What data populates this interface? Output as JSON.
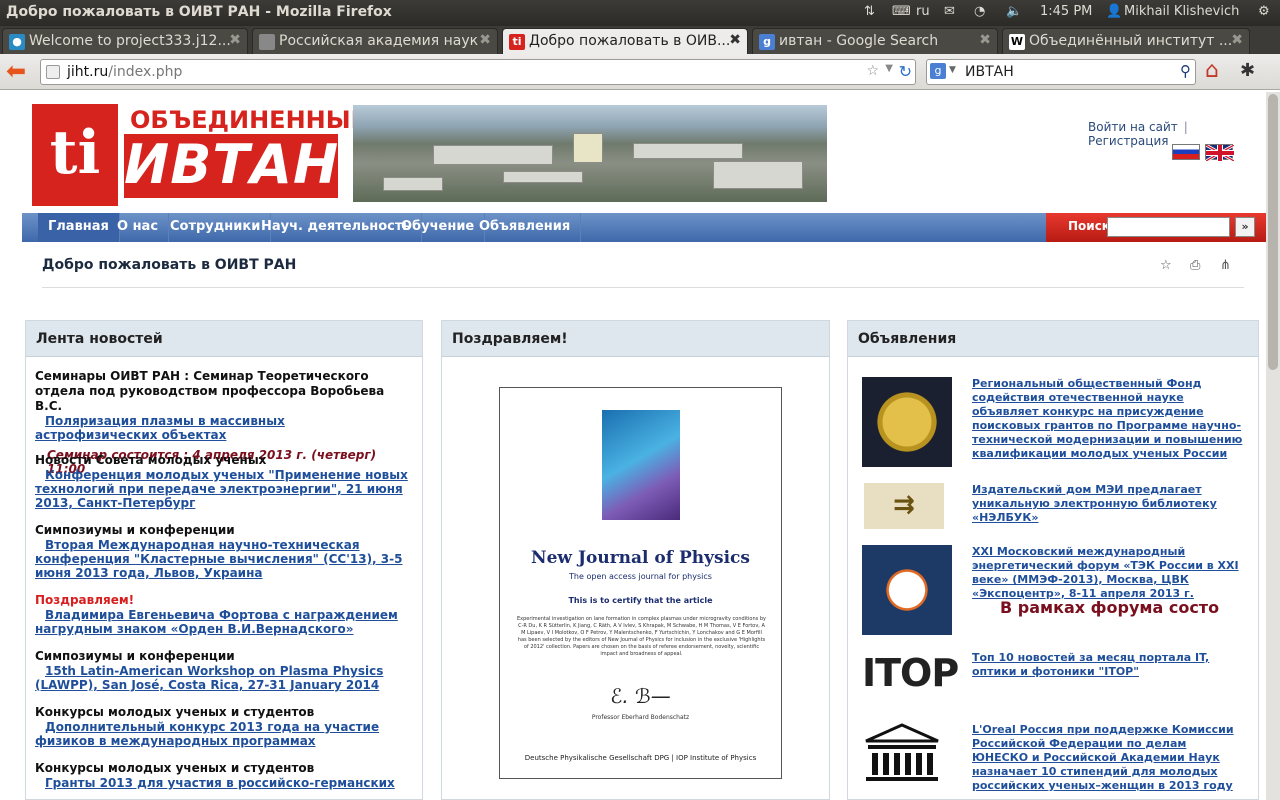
{
  "window": {
    "title": "Добро пожаловать в ОИВТ РАН - Mozilla Firefox",
    "keyboard": "ru",
    "time": "1:45 PM",
    "user": "Mikhail Klishevich"
  },
  "tabs": [
    {
      "label": "Welcome to project333.j12...",
      "icon": "drupal-icon"
    },
    {
      "label": "Российская академия наук",
      "icon": "page-icon"
    },
    {
      "label": "Добро пожаловать в ОИВ...",
      "icon": "jiht-icon",
      "active": true
    },
    {
      "label": "ивтан - Google Search",
      "icon": "google-icon"
    },
    {
      "label": "Объединённый институт ...",
      "icon": "wikipedia-icon"
    }
  ],
  "navbar": {
    "url_host": "jiht.ru",
    "url_path": "/index.php",
    "search_value": "ИВТАН"
  },
  "site": {
    "logo_top": "ОБЪЕДИНЕННЫЙ",
    "logo_main": "ИВТАН",
    "logo_letters": "ti",
    "login": "Войти на сайт",
    "register": "Регистрация",
    "login_sep": "|",
    "menu": [
      "Главная",
      "О нас",
      "Сотрудники",
      "Науч. деятельность",
      "Обучение",
      "Объявления"
    ],
    "search_label": "Поиск",
    "search_go": "»",
    "page_title": "Добро пожаловать в ОИВТ РАН"
  },
  "news": {
    "heading": "Лента новостей",
    "items": [
      {
        "category": "Семинары ОИВТ РАН : Семинар Теоретического отдела под руководством профессора Воробьева В.С.",
        "link": "Поляризация плазмы в массивных астрофизических объектах",
        "note": "Семинар состоится : 4 апреля 2013 г. (четверг) 11:00"
      },
      {
        "category": "Новости Совета молодых ученых",
        "link": "Конференция молодых ученых \"Применение новых технологий при передаче электроэнергии\", 21 июня 2013, Санкт-Петербург"
      },
      {
        "category": "Симпозиумы и конференции",
        "link": "Вторая Международная научно-техническая конференция \"Кластерные вычисления\" (CC'13), 3-5 июня 2013 года, Львов, Украина"
      },
      {
        "category": "Поздравляем!",
        "link": "Владимира Евгеньевича Фортова с награждением нагрудным знаком «Орден В.И.Вернадского»"
      },
      {
        "category": "Симпозиумы и конференции",
        "link": "15th Latin-American Workshop on Plasma Physics (LAWPP), San José, Costa Rica, 27-31 January 2014"
      },
      {
        "category": "Конкурсы молодых ученых и студентов",
        "link": "Дополнительный конкурс 2013 года на участие физиков в международных программах"
      },
      {
        "category": "Конкурсы молодых ученых и студентов",
        "link": "Гранты 2013 для участия в российско-германских"
      }
    ]
  },
  "congrats": {
    "heading": "Поздравляем!",
    "cert_title": "New Journal of Physics",
    "cert_subtitle": "The open access journal for physics",
    "cert_heading": "This is to certify that the article",
    "cert_body": "Experimental investigation on lane formation in complex plasmas under microgravity conditions by C-R Du, K R Sütterlin, K Jiang, C Räth, A V Ivlev, S Khrapak, M Schwabe, H M Thomas, V E Fortov, A M Lipaev, V I Molotkov, O F Petrov, Y Malentschenko, F Yurtschichin, Y Lonchakov and G E Morfill has been selected by the editors of New Journal of Physics for inclusion in the exclusive 'Highlights of 2012' collection. Papers are chosen on the basis of referee endorsement, novelty, scientific impact and broadness of appeal.",
    "cert_signer": "Professor Eberhard Bodenschatz",
    "cert_footer": "Deutsche Physikalische Gesellschaft  DPG | IOP Institute of Physics"
  },
  "ads": {
    "heading": "Объявления",
    "items": [
      {
        "text": "Региональный общественный Фонд содействия отечественной науке объявляет конкурс на присуждение поисковых грантов по Программе научно-технической модернизации и повышению квалификации молодых ученых России",
        "icon": "medal-icon"
      },
      {
        "text": "Издательский дом МЭИ предлагает уникальную электронную библиотеку «НЭЛБУК»",
        "icon": "mei-logo-icon"
      },
      {
        "text": "XXI Московский международный энергетический форум «ТЭК России в XXI веке» (ММЭФ-2013), Москва, ЦВК «Экспоцентр», 8-11 апреля 2013 г.",
        "icon": "tek-logo-icon",
        "marquee": "В рамках форума состо"
      },
      {
        "text": "Топ 10 новостей за месяц портала IT, оптики и фотоники \"ITOP\"",
        "icon": "itop-logo-icon",
        "logo_text": "ITOP"
      },
      {
        "text": "L'Oreal Россия при поддержке Комиссии Российской Федерации по делам ЮНЕСКО и Российской Академии Наук назначает 10 стипендий для молодых российских ученых–женщин в 2013 году",
        "icon": "unesco-logo-icon"
      }
    ]
  },
  "colors": {
    "brand_red": "#d6231d",
    "nav_blue": "#3e68ab",
    "link": "#1f4f9a"
  }
}
